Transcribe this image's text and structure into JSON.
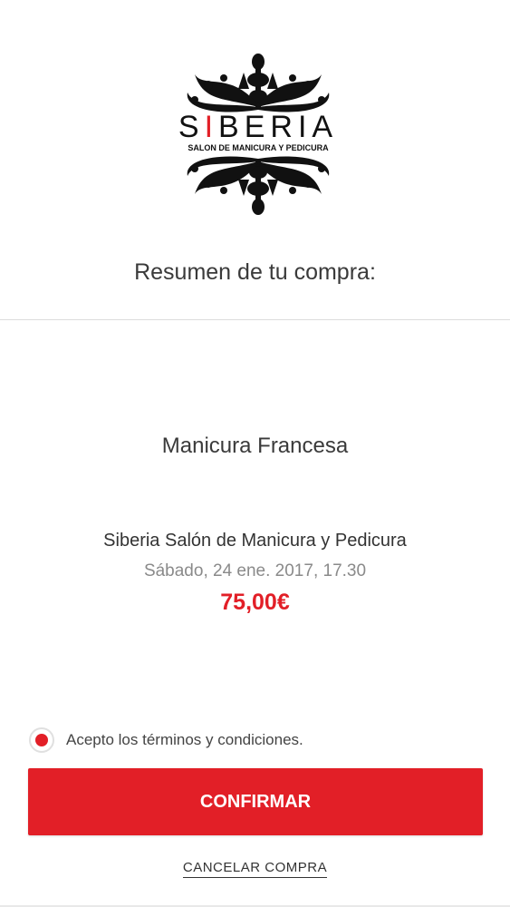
{
  "brand": {
    "logo_wordmark": "SIBERIA",
    "logo_tagline": "SALON DE MANICURA Y PEDICURA",
    "accent_color": "#e21f27"
  },
  "summary": {
    "title": "Resumen de tu compra:"
  },
  "booking": {
    "service": "Manicura Francesa",
    "salon": "Siberia Salón de Manicura y Pedicura",
    "date_time": "Sábado, 24 ene. 2017, 17.30",
    "price": "75,00€"
  },
  "terms": {
    "label": "Acepto los términos y condiciones.",
    "checked": true
  },
  "actions": {
    "confirm_label": "CONFIRMAR",
    "cancel_label": "CANCELAR COMPRA"
  }
}
